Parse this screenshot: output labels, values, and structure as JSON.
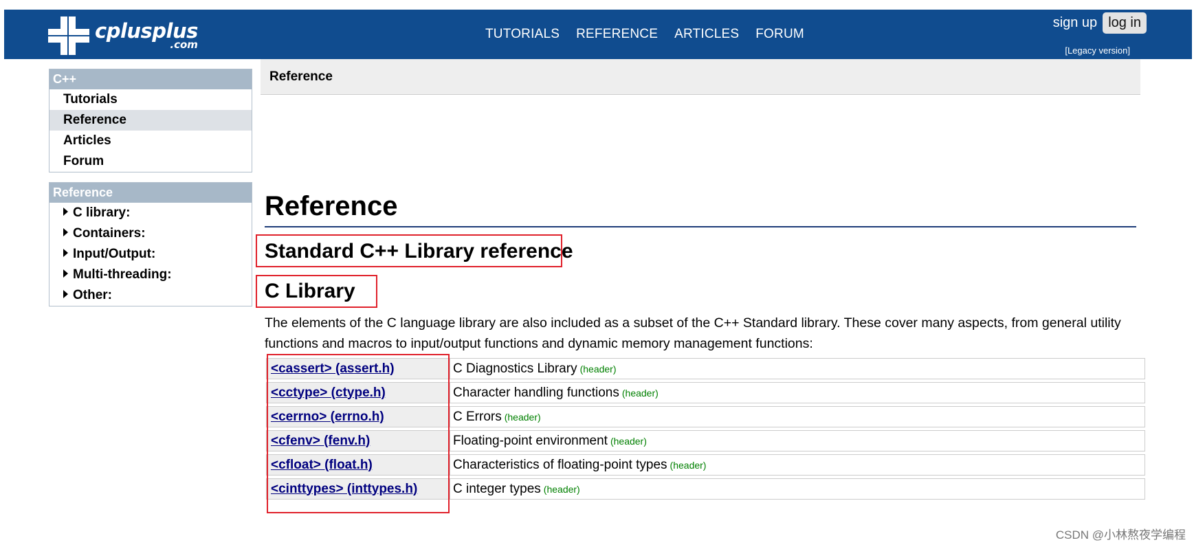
{
  "header": {
    "logo_text": "cplusplus",
    "logo_sub": ".com",
    "nav": [
      "TUTORIALS",
      "REFERENCE",
      "ARTICLES",
      "FORUM"
    ],
    "sign_up": "sign up",
    "log_in": "log in",
    "legacy": "[Legacy version]"
  },
  "sidebar": {
    "cpp_box": {
      "title": "C++",
      "items": [
        "Tutorials",
        "Reference",
        "Articles",
        "Forum"
      ],
      "active": "Reference"
    },
    "reference_box": {
      "title": "Reference",
      "items": [
        "C library:",
        "Containers:",
        "Input/Output:",
        "Multi-threading:",
        "Other:"
      ]
    }
  },
  "breadcrumb": "Reference",
  "main": {
    "title": "Reference",
    "subtitle": "Standard C++ Library reference",
    "section_title": "C Library",
    "intro": "The elements of the C language library are also included as a subset of the C++ Standard library. These cover many aspects, from general utility functions and macros to input/output functions and dynamic memory management functions:",
    "rows": [
      {
        "name": "<cassert> (assert.h)",
        "desc": "C Diagnostics Library",
        "tag": "(header)"
      },
      {
        "name": "<cctype> (ctype.h)",
        "desc": "Character handling functions",
        "tag": "(header)"
      },
      {
        "name": "<cerrno> (errno.h)",
        "desc": "C Errors",
        "tag": "(header)"
      },
      {
        "name": "<cfenv> (fenv.h)",
        "desc": "Floating-point environment",
        "tag": "(header)"
      },
      {
        "name": "<cfloat> (float.h)",
        "desc": "Characteristics of floating-point types",
        "tag": "(header)"
      },
      {
        "name": "<cinttypes> (inttypes.h)",
        "desc": "C integer types",
        "tag": "(header)"
      }
    ]
  },
  "watermark": "CSDN @小林熬夜学编程",
  "colors": {
    "topbar": "#104c8f",
    "sidebar_head": "#a7b8c8",
    "link": "#00007f",
    "header_tag": "#008000",
    "highlight_box": "#e0202a"
  }
}
